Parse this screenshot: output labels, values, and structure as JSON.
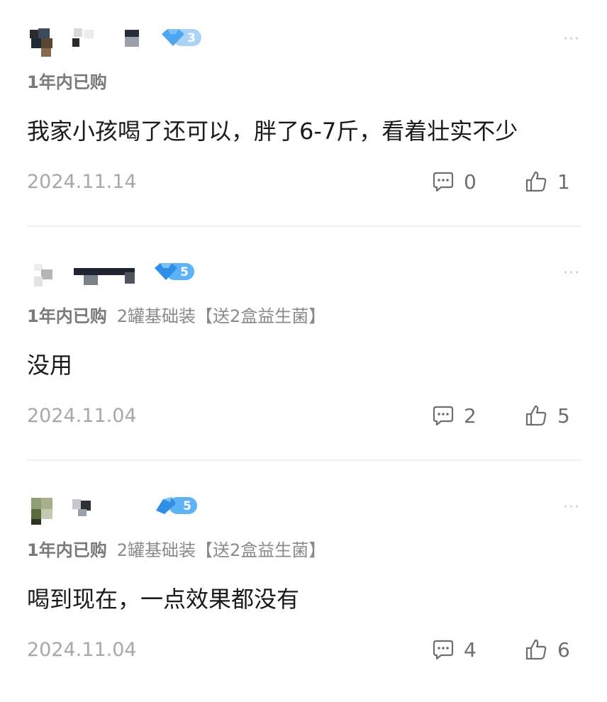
{
  "reviews": [
    {
      "user_level": "3",
      "purchase_status": "1年内已购",
      "sku": "",
      "text": "我家小孩喝了还可以，胖了6-7斤，看着壮实不少",
      "date": "2024.11.14",
      "comments": "0",
      "likes": "1"
    },
    {
      "user_level": "5",
      "purchase_status": "1年内已购",
      "sku": "2罐基础装【送2盒益生菌】",
      "text": "没用",
      "date": "2024.11.04",
      "comments": "2",
      "likes": "5"
    },
    {
      "user_level": "5",
      "purchase_status": "1年内已购",
      "sku": "2罐基础装【送2盒益生菌】",
      "text": "喝到现在，一点效果都没有",
      "date": "2024.11.04",
      "comments": "4",
      "likes": "6"
    }
  ],
  "colors": {
    "badge_blue": "#4da6f0",
    "text_primary": "#1a1a1a",
    "text_secondary": "#8a8a8a",
    "text_date": "#a8a8a8"
  },
  "icons": [
    "diamond-level-icon",
    "more-dots-icon",
    "comment-bubble-icon",
    "thumbs-up-icon"
  ]
}
